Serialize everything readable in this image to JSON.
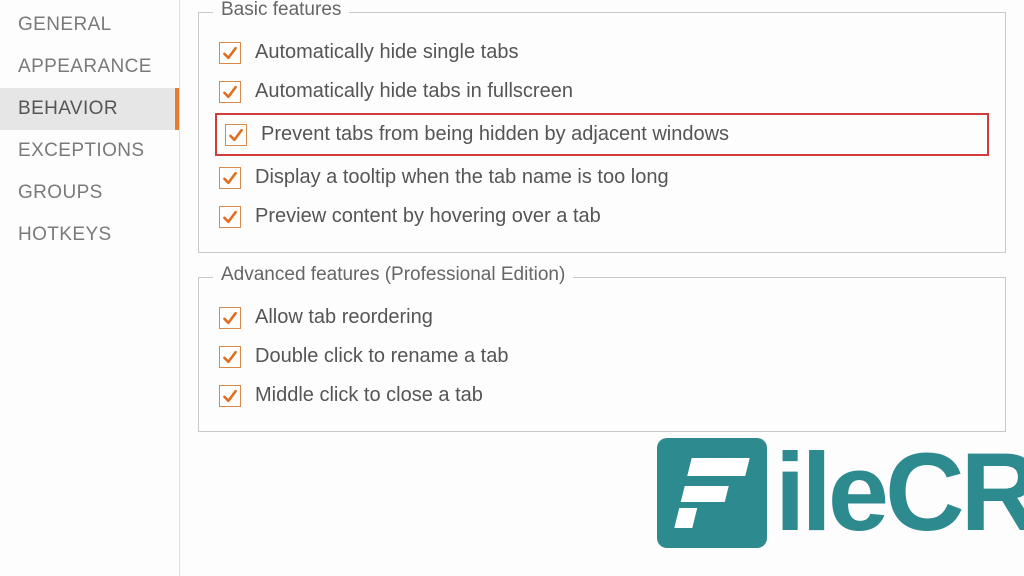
{
  "sidebar": {
    "items": [
      {
        "label": "GENERAL"
      },
      {
        "label": "APPEARANCE"
      },
      {
        "label": "BEHAVIOR",
        "active": true
      },
      {
        "label": "EXCEPTIONS"
      },
      {
        "label": "GROUPS"
      },
      {
        "label": "HOTKEYS"
      }
    ]
  },
  "groups": [
    {
      "title": "Basic features",
      "options": [
        {
          "label": "Automatically hide single tabs",
          "checked": true,
          "highlight": false
        },
        {
          "label": "Automatically hide tabs in fullscreen",
          "checked": true,
          "highlight": false
        },
        {
          "label": "Prevent tabs from being hidden by adjacent windows",
          "checked": true,
          "highlight": true
        },
        {
          "label": "Display a tooltip when the tab name is too long",
          "checked": true,
          "highlight": false
        },
        {
          "label": "Preview content by hovering over a tab",
          "checked": true,
          "highlight": false
        }
      ]
    },
    {
      "title": "Advanced features (Professional Edition)",
      "options": [
        {
          "label": "Allow tab reordering",
          "checked": true,
          "highlight": false
        },
        {
          "label": "Double click to rename a tab",
          "checked": true,
          "highlight": false
        },
        {
          "label": "Middle click to close a tab",
          "checked": true,
          "highlight": false
        }
      ]
    }
  ],
  "watermark": {
    "text": "ileCR"
  }
}
